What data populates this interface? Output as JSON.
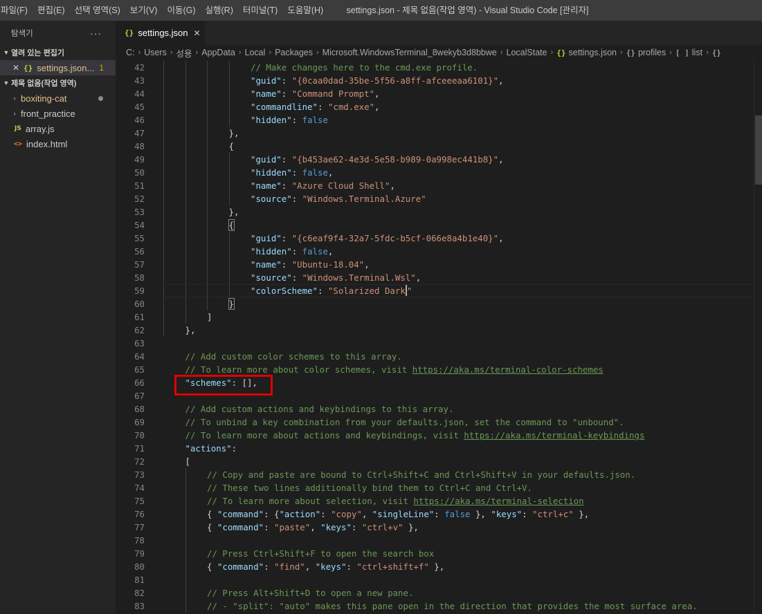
{
  "menu": [
    "파일(F)",
    "편집(E)",
    "선택 영역(S)",
    "보기(V)",
    "이동(G)",
    "실행(R)",
    "터미널(T)",
    "도움말(H)"
  ],
  "window_title": "settings.json - 제목 없음(작업 영역) - Visual Studio Code [관리자]",
  "sidebar": {
    "title": "탐색기",
    "more": "···",
    "open_editors": {
      "label": "열려 있는 편집기",
      "items": [
        {
          "name": "settings.json...",
          "badge": "1"
        }
      ]
    },
    "workspace": {
      "label": "제목 없음(작업 영역)",
      "items": [
        {
          "name": "boxiting-cat"
        },
        {
          "name": "front_practice"
        },
        {
          "name": "array.js",
          "icon": "JS"
        },
        {
          "name": "index.html",
          "icon": "<>"
        }
      ]
    }
  },
  "tab": {
    "label": "settings.json",
    "icon": "{}"
  },
  "breadcrumb": [
    "C:",
    "Users",
    "성용",
    "AppData",
    "Local",
    "Packages",
    "Microsoft.WindowsTerminal_8wekyb3d8bbwe",
    "LocalState",
    "settings.json",
    "profiles",
    "list",
    ""
  ],
  "code_lines": [
    {
      "n": 42,
      "t": [
        [
          "c",
          "// Make changes here to the cmd.exe profile."
        ]
      ]
    },
    {
      "n": 43,
      "t": [
        [
          "k",
          "\"guid\""
        ],
        [
          "p",
          ": "
        ],
        [
          "s",
          "\"{0caa0dad-35be-5f56-a8ff-afceeeaa6101}\""
        ],
        [
          "p",
          ","
        ]
      ]
    },
    {
      "n": 44,
      "t": [
        [
          "k",
          "\"name\""
        ],
        [
          "p",
          ": "
        ],
        [
          "s",
          "\"Command Prompt\""
        ],
        [
          "p",
          ","
        ]
      ]
    },
    {
      "n": 45,
      "t": [
        [
          "k",
          "\"commandline\""
        ],
        [
          "p",
          ": "
        ],
        [
          "s",
          "\"cmd.exe\""
        ],
        [
          "p",
          ","
        ]
      ]
    },
    {
      "n": 46,
      "t": [
        [
          "k",
          "\"hidden\""
        ],
        [
          "p",
          ": "
        ],
        [
          "b",
          "false"
        ]
      ]
    },
    {
      "n": 47,
      "t": [
        [
          "p",
          "},"
        ]
      ]
    },
    {
      "n": 48,
      "t": [
        [
          "p",
          "{"
        ]
      ]
    },
    {
      "n": 49,
      "t": [
        [
          "k",
          "\"guid\""
        ],
        [
          "p",
          ": "
        ],
        [
          "s",
          "\"{b453ae62-4e3d-5e58-b989-0a998ec441b8}\""
        ],
        [
          "p",
          ","
        ]
      ]
    },
    {
      "n": 50,
      "t": [
        [
          "k",
          "\"hidden\""
        ],
        [
          "p",
          ": "
        ],
        [
          "b",
          "false"
        ],
        [
          "p",
          ","
        ]
      ]
    },
    {
      "n": 51,
      "t": [
        [
          "k",
          "\"name\""
        ],
        [
          "p",
          ": "
        ],
        [
          "s",
          "\"Azure Cloud Shell\""
        ],
        [
          "p",
          ","
        ]
      ]
    },
    {
      "n": 52,
      "t": [
        [
          "k",
          "\"source\""
        ],
        [
          "p",
          ": "
        ],
        [
          "s",
          "\"Windows.Terminal.Azure\""
        ]
      ]
    },
    {
      "n": 53,
      "t": [
        [
          "p",
          "},"
        ]
      ]
    },
    {
      "n": 54,
      "t": [
        [
          "p",
          "{"
        ]
      ]
    },
    {
      "n": 55,
      "t": [
        [
          "k",
          "\"guid\""
        ],
        [
          "p",
          ": "
        ],
        [
          "s",
          "\"{c6eaf9f4-32a7-5fdc-b5cf-066e8a4b1e40}\""
        ],
        [
          "p",
          ","
        ]
      ]
    },
    {
      "n": 56,
      "t": [
        [
          "k",
          "\"hidden\""
        ],
        [
          "p",
          ": "
        ],
        [
          "b",
          "false"
        ],
        [
          "p",
          ","
        ]
      ]
    },
    {
      "n": 57,
      "t": [
        [
          "k",
          "\"name\""
        ],
        [
          "p",
          ": "
        ],
        [
          "s",
          "\"Ubuntu-18.04\""
        ],
        [
          "p",
          ","
        ]
      ]
    },
    {
      "n": 58,
      "t": [
        [
          "k",
          "\"source\""
        ],
        [
          "p",
          ": "
        ],
        [
          "s",
          "\"Windows.Terminal.Wsl\""
        ],
        [
          "p",
          ","
        ]
      ]
    },
    {
      "n": 59,
      "t": [
        [
          "k",
          "\"colorScheme\""
        ],
        [
          "p",
          ": "
        ],
        [
          "s",
          "\"Solarized Dark"
        ],
        [
          "caret",
          ""
        ],
        [
          "s",
          "\""
        ]
      ]
    },
    {
      "n": 60,
      "t": [
        [
          "p",
          "}"
        ]
      ]
    },
    {
      "n": 61,
      "t": [
        [
          "p",
          "]"
        ]
      ]
    },
    {
      "n": 62,
      "t": [
        [
          "p",
          "},"
        ]
      ]
    },
    {
      "n": 63,
      "t": []
    },
    {
      "n": 64,
      "t": [
        [
          "c",
          "// Add custom color schemes to this array."
        ]
      ]
    },
    {
      "n": 65,
      "t": [
        [
          "c",
          "// To learn more about color schemes, visit "
        ],
        [
          "u",
          "https://aka.ms/terminal-color-schemes"
        ]
      ]
    },
    {
      "n": 66,
      "t": [
        [
          "k",
          "\"schemes\""
        ],
        [
          "p",
          ": [],"
        ]
      ]
    },
    {
      "n": 67,
      "t": []
    },
    {
      "n": 68,
      "t": [
        [
          "c",
          "// Add custom actions and keybindings to this array."
        ]
      ]
    },
    {
      "n": 69,
      "t": [
        [
          "c",
          "// To unbind a key combination from your defaults.json, set the command to \"unbound\"."
        ]
      ]
    },
    {
      "n": 70,
      "t": [
        [
          "c",
          "// To learn more about actions and keybindings, visit "
        ],
        [
          "u",
          "https://aka.ms/terminal-keybindings"
        ]
      ]
    },
    {
      "n": 71,
      "t": [
        [
          "k",
          "\"actions\""
        ],
        [
          "p",
          ":"
        ]
      ]
    },
    {
      "n": 72,
      "t": [
        [
          "p",
          "["
        ]
      ]
    },
    {
      "n": 73,
      "t": [
        [
          "c",
          "// Copy and paste are bound to Ctrl+Shift+C and Ctrl+Shift+V in your defaults.json."
        ]
      ]
    },
    {
      "n": 74,
      "t": [
        [
          "c",
          "// These two lines additionally bind them to Ctrl+C and Ctrl+V."
        ]
      ]
    },
    {
      "n": 75,
      "t": [
        [
          "c",
          "// To learn more about selection, visit "
        ],
        [
          "u",
          "https://aka.ms/terminal-selection"
        ]
      ]
    },
    {
      "n": 76,
      "t": [
        [
          "p",
          "{ "
        ],
        [
          "k",
          "\"command\""
        ],
        [
          "p",
          ": {"
        ],
        [
          "k",
          "\"action\""
        ],
        [
          "p",
          ": "
        ],
        [
          "s",
          "\"copy\""
        ],
        [
          "p",
          ", "
        ],
        [
          "k",
          "\"singleLine\""
        ],
        [
          "p",
          ": "
        ],
        [
          "b",
          "false"
        ],
        [
          "p",
          " }, "
        ],
        [
          "k",
          "\"keys\""
        ],
        [
          "p",
          ": "
        ],
        [
          "s",
          "\"ctrl+c\""
        ],
        [
          "p",
          " },"
        ]
      ]
    },
    {
      "n": 77,
      "t": [
        [
          "p",
          "{ "
        ],
        [
          "k",
          "\"command\""
        ],
        [
          "p",
          ": "
        ],
        [
          "s",
          "\"paste\""
        ],
        [
          "p",
          ", "
        ],
        [
          "k",
          "\"keys\""
        ],
        [
          "p",
          ": "
        ],
        [
          "s",
          "\"ctrl+v\""
        ],
        [
          "p",
          " },"
        ]
      ]
    },
    {
      "n": 78,
      "t": []
    },
    {
      "n": 79,
      "t": [
        [
          "c",
          "// Press Ctrl+Shift+F to open the search box"
        ]
      ]
    },
    {
      "n": 80,
      "t": [
        [
          "p",
          "{ "
        ],
        [
          "k",
          "\"command\""
        ],
        [
          "p",
          ": "
        ],
        [
          "s",
          "\"find\""
        ],
        [
          "p",
          ", "
        ],
        [
          "k",
          "\"keys\""
        ],
        [
          "p",
          ": "
        ],
        [
          "s",
          "\"ctrl+shift+f\""
        ],
        [
          "p",
          " },"
        ]
      ]
    },
    {
      "n": 81,
      "t": []
    },
    {
      "n": 82,
      "t": [
        [
          "c",
          "// Press Alt+Shift+D to open a new pane."
        ]
      ]
    },
    {
      "n": 83,
      "t": [
        [
          "c",
          "// - \"split\": \"auto\" makes this pane open in the direction that provides the most surface area."
        ]
      ]
    }
  ]
}
